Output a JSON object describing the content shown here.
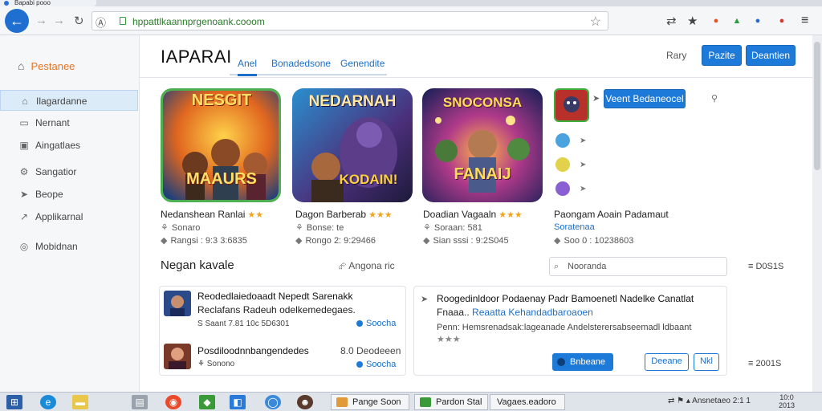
{
  "browser": {
    "tab_title": "Bapabi pooo",
    "url": "hppattlkaannprgenoank.cooom",
    "back_icon": "arrow-left-icon",
    "extensions": [
      {
        "name": "extension-orange-icon",
        "glyph": "●",
        "color": "#e8501f"
      },
      {
        "name": "extension-green-icon",
        "glyph": "▲",
        "color": "#2e9b45"
      },
      {
        "name": "extension-blue-icon",
        "glyph": "●",
        "color": "#2569c9"
      },
      {
        "name": "extension-red-icon",
        "glyph": "●",
        "color": "#d13b2a"
      }
    ]
  },
  "sidebar": {
    "brand": "Pestanee",
    "items": [
      {
        "label": "Ilagardanne",
        "icon": "home-icon",
        "glyph": "⌂"
      },
      {
        "label": "Nernant",
        "icon": "document-icon",
        "glyph": "▭"
      },
      {
        "label": "Aingatlaes",
        "icon": "image-icon",
        "glyph": "▣"
      },
      {
        "label": "Sangatior",
        "icon": "settings-icon",
        "glyph": "⚙"
      },
      {
        "label": "Beope",
        "icon": "pointer-icon",
        "glyph": "➤"
      },
      {
        "label": "Applikarnal",
        "icon": "share-icon",
        "glyph": "↗"
      },
      {
        "label": "Mobidnan",
        "icon": "circle-icon",
        "glyph": "◎"
      }
    ]
  },
  "header": {
    "title": "IAPARAI",
    "tabs": [
      "Anel",
      "Bonadedsone",
      "Genendite"
    ],
    "link": "Rary",
    "buttons": [
      "Pazite",
      "Deantien"
    ]
  },
  "apps": [
    {
      "art_title": "NESGIT",
      "art_subtitle": "MAAURS",
      "name": "Nedanshean Ranlai",
      "stars": "★★",
      "sub": "Sonaro",
      "meta": "Rangsi : 9:3 3:6835",
      "colors": {
        "bg1": "#f7b02a",
        "bg2": "#2a76c9",
        "border": "#4caf50"
      }
    },
    {
      "art_title": "NEDARNAH",
      "art_subtitle": "KODAIN!",
      "name": "Dagon Barberab",
      "stars": "★★★",
      "sub": "Bonse: te",
      "meta": "Rongo 2: 9:29466",
      "colors": {
        "bg1": "#1a5c8f",
        "bg2": "#6f3b8f",
        "border": "#333333"
      }
    },
    {
      "art_title": "SNOCONSA",
      "art_subtitle": "FANAIJ",
      "name": "Doadian Vagaaln",
      "stars": "★★★",
      "sub": "Soraan: 581",
      "meta": "Sian sssi : 9:2S045",
      "colors": {
        "bg1": "#ff8a1d",
        "bg2": "#3c2c86",
        "border": "#333333"
      }
    },
    {
      "name": "Paongam Aoain Padamaut",
      "sub": "Soratenaa",
      "meta": "Soo 0 : 10238603"
    }
  ],
  "side_panel": {
    "button": "Veent Bedaneocel",
    "dot_colors": [
      "#4aa3df",
      "#e2d24b",
      "#8a5fd1"
    ]
  },
  "section": {
    "title": "Negan kavale",
    "share": "Angona  ric",
    "search_placeholder": "Nooranda",
    "count_top": "D0S1S",
    "count_bottom": "2001S"
  },
  "list_left": [
    {
      "title": "Reodedlaiedoaadt Nepedt Sarenakk",
      "sub": "Reclafans Radeuh odelkemedegaes.",
      "meta": "S Saant 7.81 10c 5D6301",
      "link": "Soocha"
    },
    {
      "title": "Posdiloodnnbangendedes",
      "right": "8.0 Deodeeen",
      "meta": "Sonono",
      "link": "Soocha"
    }
  ],
  "list_right": {
    "line1": "Roogedinldoor Podaenay  Padr Bamoenetl Nadelke Canatlat",
    "line2_a": "Fnaaa..",
    "line2_b": "Reaatta Kehandadbaroaoen",
    "line3": "Penn: Hemsrenadsak:lageanade  Andelsterersabseemadl ldbaant",
    "stars": "★★★",
    "btn_primary": "Bnbeane",
    "btn_secondary": "Deeane",
    "btn_tertiary": "Nkl"
  },
  "taskbar": {
    "tasks": [
      "Pange Soon",
      "Pardon Stal",
      "Vagaes.eadoro"
    ],
    "tray": "Ansnetaeo 2:1 1",
    "clock": "10:0\n2013"
  }
}
